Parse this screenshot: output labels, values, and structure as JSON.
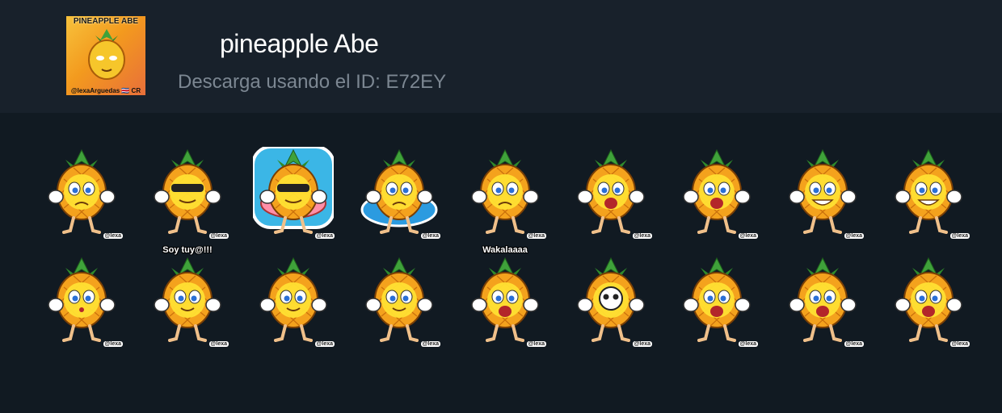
{
  "pack": {
    "title": "pineapple Abe",
    "subtitle": "Descarga usando el ID: E72EY",
    "cover_title": "PINEAPPLE ABE",
    "cover_credit": "@lexaArguedas 🇨🇷 CR"
  },
  "stickers": [
    {
      "icon": "crying-pineapple-sticker",
      "caption": "",
      "watermark": "@lexa"
    },
    {
      "icon": "sunglasses-pineapple-sticker",
      "caption": "",
      "watermark": "@lexa"
    },
    {
      "icon": "pool-float-pineapple-sticker",
      "caption": "",
      "watermark": "@lexa"
    },
    {
      "icon": "melting-pineapple-sticker",
      "caption": "",
      "watermark": "@lexa"
    },
    {
      "icon": "sweating-pineapple-sticker",
      "caption": "",
      "watermark": "@lexa"
    },
    {
      "icon": "shocked-pineapple-sticker",
      "caption": "",
      "watermark": "@lexa"
    },
    {
      "icon": "laughing-pineapple-sticker",
      "caption": "",
      "watermark": "@lexa"
    },
    {
      "icon": "flying-pineapple-sticker",
      "caption": "",
      "watermark": "@lexa"
    },
    {
      "icon": "grinning-pineapple-sticker",
      "caption": "",
      "watermark": "@lexa"
    },
    {
      "icon": "kissing-pineapple-sticker",
      "caption": "",
      "watermark": "@lexa"
    },
    {
      "icon": "hula-pineapple-sticker",
      "caption": "Soy tuy@!!!",
      "watermark": "@lexa"
    },
    {
      "icon": "thumbs-up-pineapple-sticker",
      "caption": "",
      "watermark": "@lexa"
    },
    {
      "icon": "toasting-pineapple-sticker",
      "caption": "",
      "watermark": "@lexa"
    },
    {
      "icon": "eating-pineapple-sticker",
      "caption": "Wakalaaaa",
      "watermark": "@lexa"
    },
    {
      "icon": "skull-pineapple-sticker",
      "caption": "",
      "watermark": "@lexa"
    },
    {
      "icon": "screaming-pineapple-sticker",
      "caption": "",
      "watermark": "@lexa"
    },
    {
      "icon": "worried-pineapple-sticker",
      "caption": "",
      "watermark": "@lexa"
    },
    {
      "icon": "exploding-pineapple-sticker",
      "caption": "",
      "watermark": "@lexa"
    }
  ],
  "colors": {
    "background": "#111a22",
    "header": "#18212b",
    "pineapple": "#f4a21d",
    "leaves": "#3fa23a",
    "face": "#ffe033"
  }
}
